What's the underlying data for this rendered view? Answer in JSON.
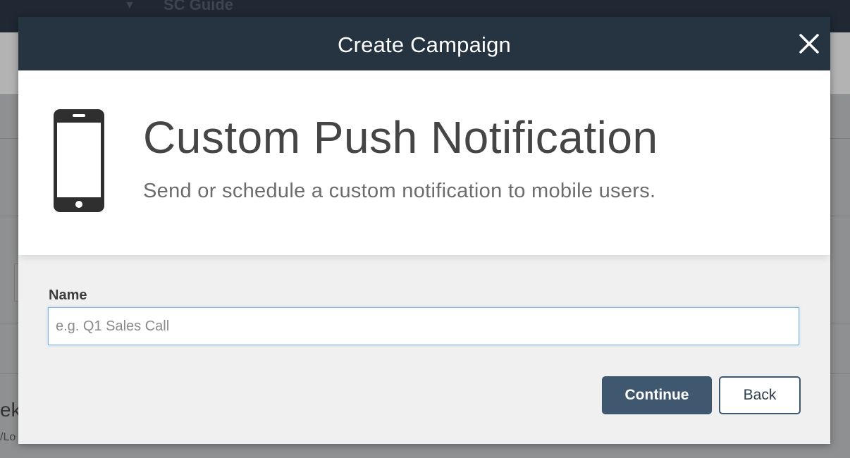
{
  "background": {
    "topbar_title": "SC Guide",
    "caret_glyph": "▼",
    "partial_text": "ek",
    "partial_subtext": "/Lo"
  },
  "modal": {
    "title": "Create Campaign",
    "close_icon": "close-icon",
    "hero": {
      "icon": "smartphone-icon",
      "title": "Custom Push Notification",
      "subtitle": "Send or schedule a custom notification to mobile users."
    },
    "form": {
      "name_label": "Name",
      "name_value": "",
      "name_placeholder": "e.g. Q1 Sales Call"
    },
    "buttons": {
      "continue_label": "Continue",
      "back_label": "Back"
    }
  },
  "colors": {
    "header_bg": "#263341",
    "primary_button": "#3f5870",
    "input_focus_border": "#7db3e6",
    "modal_bg": "#f0f0f0"
  }
}
